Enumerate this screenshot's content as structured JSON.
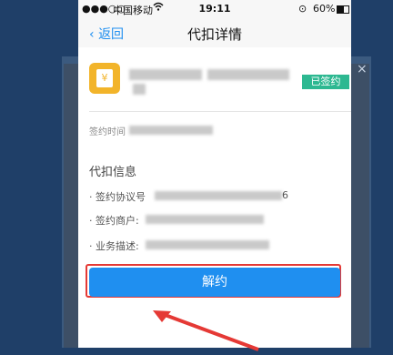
{
  "status_bar": {
    "signal": "●●●○○",
    "carrier": "中国移动",
    "time": "19:11",
    "battery": "60%"
  },
  "nav": {
    "back_label": "返回",
    "title": "代扣详情"
  },
  "merchant": {
    "signed_badge": "已签约",
    "sign_time_label": "签约时间"
  },
  "details": {
    "section_title": "代扣信息",
    "rows": [
      {
        "label": "· 签约协议号",
        "tail": "6"
      },
      {
        "label": "· 签约商户:",
        "tail": ""
      },
      {
        "label": "· 业务描述:",
        "tail": ""
      }
    ]
  },
  "unbind_button": "解约",
  "colors": {
    "accent_blue": "#1f8ff0",
    "badge_green": "#2db891",
    "highlight_red": "#e53935"
  }
}
